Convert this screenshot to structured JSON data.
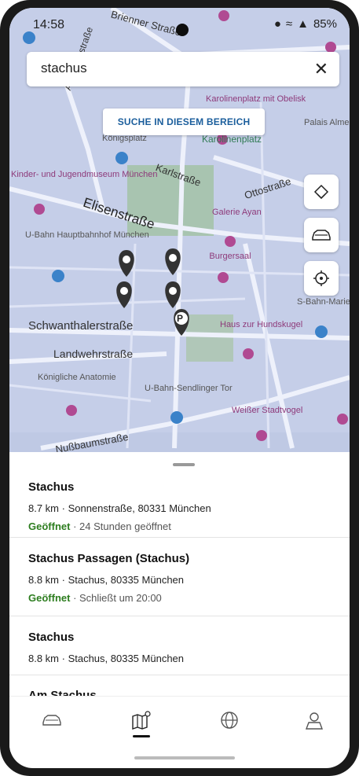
{
  "status": {
    "time": "14:58",
    "battery": "85%"
  },
  "search": {
    "value": "stachus",
    "clear_icon": "close-icon"
  },
  "map": {
    "search_area_button": "SUCHE IN DIESEM BEREICH",
    "labels": {
      "koenigsplatz": "Königsplatz",
      "karolinenplatz": "Karolinenplatz",
      "karolinenplatz_obelisk": "Karolinenplatz mit Obelisk",
      "palais_almeida": "Palais Almeida",
      "kindermuseum": "Kinder- und Jugendmuseum München",
      "karlstrasse": "Karlstraße",
      "ottostrasse": "Ottostraße",
      "elisenstrasse": "Elisenstraße",
      "galerie_ayan": "Galerie Ayan",
      "ubahn_hbf": "U-Bahn Hauptbahnhof München",
      "burgersaal": "Burgersaal",
      "sbahn_marienplatz": "S-Bahn-Marienplatz",
      "schwanthalerstrasse": "Schwanthalerstraße",
      "haus_zur_hundskugel": "Haus zur Hundskugel",
      "landwehrstrasse": "Landwehrstraße",
      "koenigliche_anatomie": "Königliche Anatomie",
      "ubahn_sendlinger_tor": "U-Bahn-Sendlinger Tor",
      "weisser_stadtvogel": "Weißer Stadtvogel",
      "nussbaumstrasse": "Nußbaumstraße",
      "augustenstrasse": "Augustenstraße",
      "brienner_strasse": "Brienner Straße"
    },
    "fab_icons": [
      "layers-icon",
      "car-icon",
      "locate-icon"
    ],
    "parking_marker": "P"
  },
  "results": [
    {
      "title": "Stachus",
      "address": "8.7 km · Sonnenstraße, 80331 München",
      "status": "Geöffnet",
      "hours": " · 24 Stunden geöffnet"
    },
    {
      "title": "Stachus Passagen (Stachus)",
      "address": "8.8 km · Stachus, 80335 München",
      "status": "Geöffnet",
      "hours": " · Schließt um 20:00"
    },
    {
      "title": "Stachus",
      "address": "8.8 km · Stachus, 80335 München"
    },
    {
      "title": "Am Stachus"
    }
  ],
  "nav": {
    "items": [
      "car-icon",
      "map-icon",
      "globe-icon",
      "profile-icon"
    ],
    "active": "map-icon"
  },
  "colors": {
    "accent": "#1b5e9c",
    "open": "#2d7d1f",
    "map_bg": "#c9d2ea"
  }
}
